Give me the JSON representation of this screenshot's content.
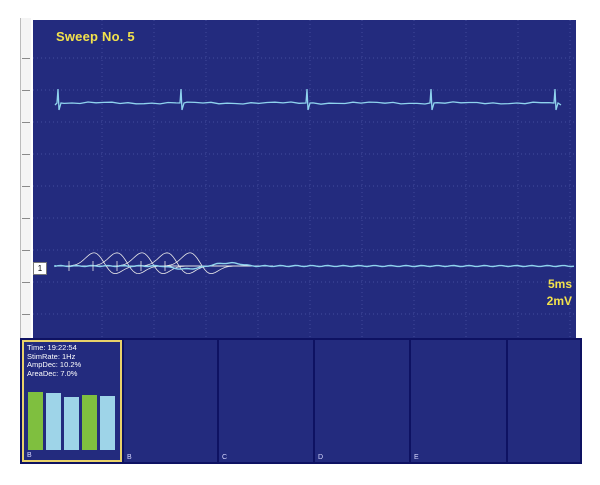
{
  "scope": {
    "sweep_label": "Sweep No. 5",
    "time_scale": "5ms",
    "amp_scale": "2mV",
    "channel_marker": "1",
    "colors": {
      "background": "#232b7e",
      "trace": "#8fd3ee",
      "label": "#f2e24c",
      "overlay": "#e9e9e9"
    }
  },
  "train_panel": {
    "stats": {
      "time": "Time: 19:22:54",
      "stim_rate": "StimRate: 1Hz",
      "amp_dec": "AmpDec: 10.2%",
      "area_dec": "AreaDec: 7.0%"
    },
    "bars": [
      {
        "relative_amplitude": 0.83,
        "color": "#7fbf3f"
      },
      {
        "relative_amplitude": 0.81,
        "color": "#9ed4e8"
      },
      {
        "relative_amplitude": 0.75,
        "color": "#9ed4e8"
      },
      {
        "relative_amplitude": 0.79,
        "color": "#7fbf3f"
      },
      {
        "relative_amplitude": 0.77,
        "color": "#9ed4e8"
      }
    ]
  },
  "panels": [
    {
      "label": "B"
    },
    {
      "label": "B"
    },
    {
      "label": "C"
    },
    {
      "label": "D"
    },
    {
      "label": "E"
    },
    {
      "label": ""
    }
  ]
}
